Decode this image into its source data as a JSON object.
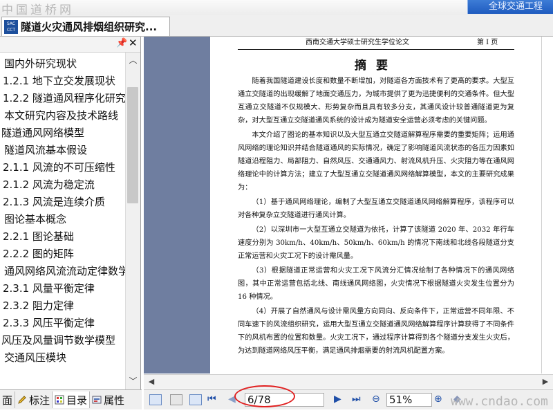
{
  "watermark_top": "中国道桥网",
  "watermark_bottom": "www.cndao.com",
  "top_right_text": "全球交通工程",
  "tab": {
    "icon_text": "SAC\nCCT",
    "title": "隧道火灾通风排烟组织研究..."
  },
  "panel": {
    "pin_glyph": "📌",
    "close_glyph": "✕",
    "toc": [
      "国内外研究现状",
      "1.2.1 地下立交发展现状",
      "1.2.2 隧道通风程序化研究",
      "本文研究内容及技术路线",
      "隧道通风网络模型",
      "隧道风流基本假设",
      "2.1.1 风流的不可压缩性",
      "2.1.2 风流为稳定流",
      "2.1.3 风流是连续介质",
      "图论基本概念",
      "2.2.1 图论基础",
      "2.2.2 图的矩阵",
      "通风网络风流流动定律数学",
      "2.3.1 风量平衡定律",
      "2.3.2 阻力定律",
      "2.3.3 风压平衡定律",
      "风压及风量调节数学模型",
      "交通风压模块"
    ],
    "tabs": [
      {
        "icon": "page-icon",
        "label": "面"
      },
      {
        "icon": "pencil-icon",
        "label": "标注"
      },
      {
        "icon": "grid-icon",
        "label": "目录"
      },
      {
        "icon": "properties-icon",
        "label": "属性"
      }
    ]
  },
  "page": {
    "header_title": "西南交通大学硕士研究生学位论文",
    "header_page": "第 I 页",
    "heading": "摘要",
    "paragraphs": [
      "随着我国隧道建设长度和数量不断增加，对隧道各方面技术有了更高的要求。大型互通立交隧道的出现缓解了地面交通压力，为城市提供了更为迅捷便利的交通条件。但大型互通立交隧道不仅规模大、形势复杂而且具有较多分支，其通风设计较普通隧道更为复杂，对大型互通立交隧道通风系统的设计成为隧道安全运营必须考虑的关键问题。",
      "本文介绍了图论的基本知识以及大型互通立交隧道解算程序需要的重要矩阵；运用通风网络的理论知识并结合隧道通风的实际情况，确定了影响隧道风流状态的各压力因素如隧道沿程阻力、局部阻力、自然风压、交通通风力、射流风机升压、火灾阻力等在通风网络理论中的计算方法；建立了大型互通立交隧道通风网络解算模型，本文的主要研究成果为：",
      "（1）基于通风网络理论，编制了大型互通立交隧道通风网络解算程序，该程序可以对各种复杂立交隧道进行通风计算。",
      "（2）以深圳市一大型互通立交隧道为依托，计算了该隧道 2020 年、2032 年行车速度分别为 30km/h、40km/h、50km/h、60km/h 的情况下南线和北线各段隧道分支正常运营和火灾工况下的设计需风量。",
      "（3）根据隧道正常运营和火灾工况下风流分汇情况绘制了各种情况下的通风网络图，其中正常运营包括北线、南线通风网络图，火灾情况下根据隧道火灾发生位置分为 16 种情况。",
      "（4）开展了自然通风与设计需风量方向同向、反向条件下，正常运营不同年限、不同车速下的风流组织研究，运用大型互通立交隧道通风网络解算程序计算获得了不同条件下的风机布置的位置和数量。火灾工况下，通过程序计算得到各个隧道分支发生火灾后，为达到隧道网络风压平衡，满足通风排烟需要的射流风机配置方案。"
    ]
  },
  "status": {
    "page_indicator": "6/78",
    "zoom": "51%",
    "glyphs": {
      "first": "⏮",
      "prev": "◀",
      "next": "▶",
      "last": "⏭",
      "zoom_out": "⊖",
      "zoom_in": "⊕",
      "fit": "◆"
    }
  },
  "colors": {
    "annotation_circle": "#e02020",
    "doc_background": "#6f7ea0",
    "accent": "#1f5bbf"
  }
}
